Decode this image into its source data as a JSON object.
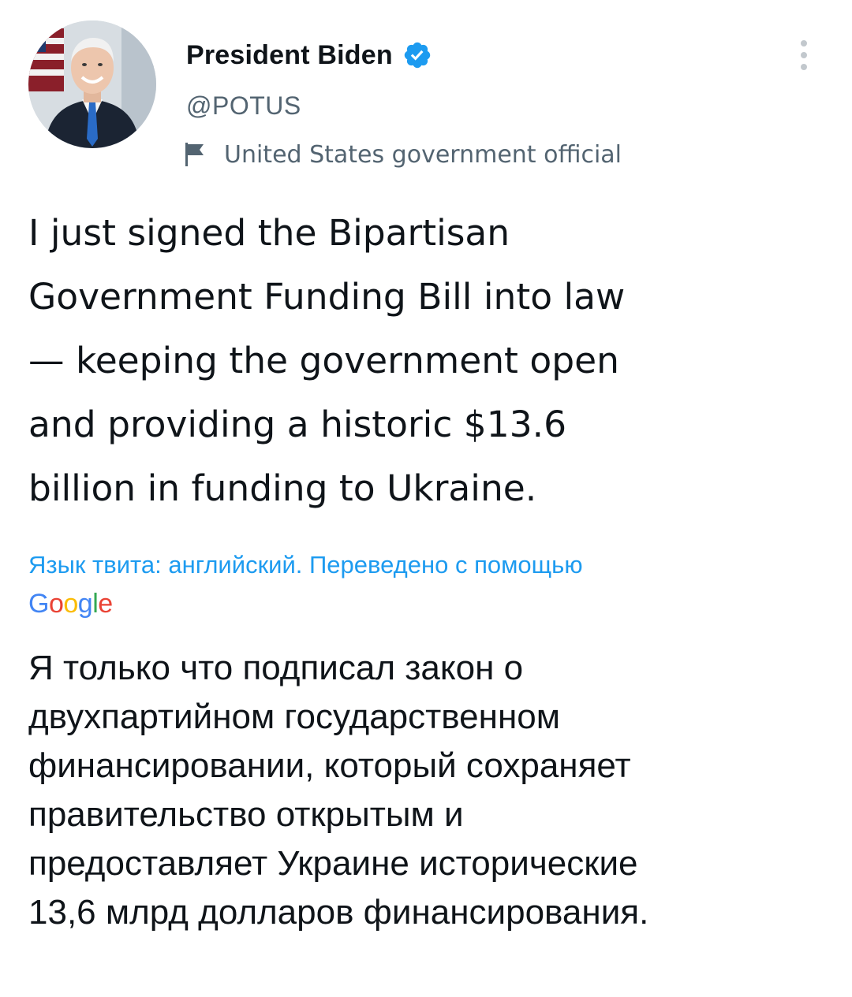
{
  "author": {
    "display_name": "President Biden",
    "handle": "@POTUS",
    "label": "United States government official",
    "verified": true
  },
  "tweet": {
    "lines": [
      "I just signed the Bipartisan",
      "Government Funding Bill into law",
      "— keeping the government open",
      "and providing a historic $13.6",
      "billion in funding to Ukraine."
    ]
  },
  "translation": {
    "note": "Язык твита: английский. Переведено с помощью",
    "provider": "Google",
    "lines": [
      "Я только что подписал закон о",
      "двухпартийном государственном",
      "финансировании, который сохраняет",
      "правительство открытым и",
      "предоставляет Украине исторические",
      "13,6 млрд долларов финансирования."
    ]
  },
  "colors": {
    "text": "#0f1419",
    "secondary": "#536471",
    "accent": "#1d9bf0",
    "google_blue": "#4285f4",
    "google_red": "#ea4335",
    "google_yellow": "#fbbc05",
    "google_green": "#34a853"
  },
  "icons": {
    "verified": "verified-badge-icon",
    "label": "flag-icon",
    "more": "more-vertical-icon"
  }
}
